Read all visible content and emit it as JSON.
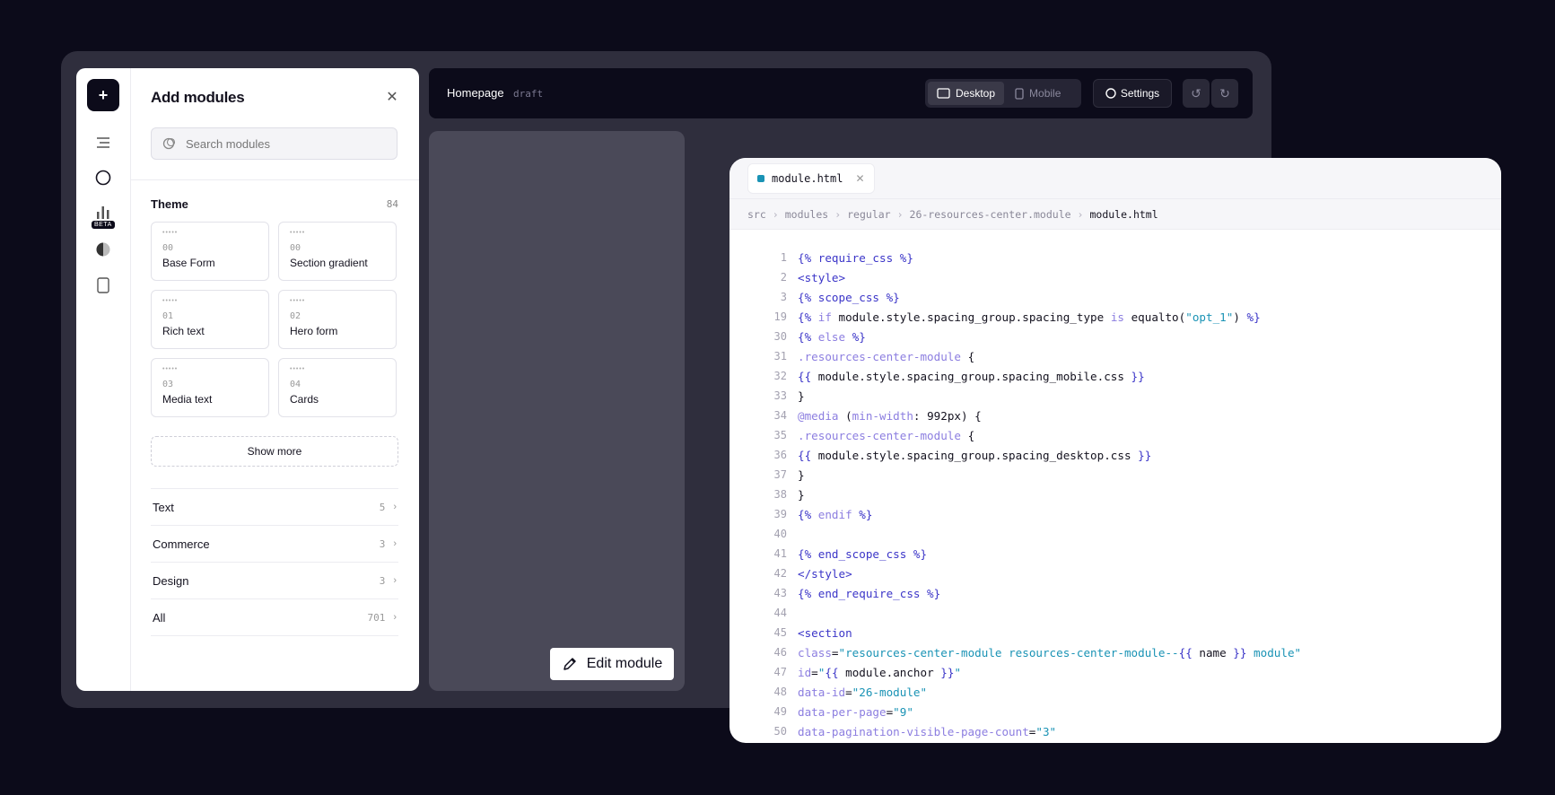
{
  "sidebar": {
    "add_icon": "plus-icon",
    "beta_label": "BETA",
    "items": [
      "layers-icon",
      "circle-icon",
      "chart-icon",
      "theme-icon",
      "page-icon"
    ]
  },
  "panel": {
    "title": "Add modules",
    "search_placeholder": "Search modules",
    "theme": {
      "label": "Theme",
      "count": "84"
    },
    "modules": [
      {
        "num": "00",
        "name": "Base Form"
      },
      {
        "num": "00",
        "name": "Section gradient"
      },
      {
        "num": "01",
        "name": "Rich text"
      },
      {
        "num": "02",
        "name": "Hero form"
      },
      {
        "num": "03",
        "name": "Media text"
      },
      {
        "num": "04",
        "name": "Cards"
      }
    ],
    "show_more": "Show more",
    "categories": [
      {
        "label": "Text",
        "count": "5"
      },
      {
        "label": "Commerce",
        "count": "3"
      },
      {
        "label": "Design",
        "count": "3"
      },
      {
        "label": "All",
        "count": "701"
      }
    ]
  },
  "topbar": {
    "page_name": "Homepage",
    "status": "draft",
    "desktop_label": "Desktop",
    "mobile_label": "Mobile",
    "settings_label": "Settings"
  },
  "canvas": {
    "edit_label": "Edit module"
  },
  "editor": {
    "tab_name": "module.html",
    "breadcrumbs": [
      "src",
      "modules",
      "regular",
      "26-resources-center.module",
      "module.html"
    ],
    "line_numbers": [
      "1",
      "2",
      "3",
      "19",
      "30",
      "31",
      "32",
      "33",
      "34",
      "35",
      "36",
      "37",
      "38",
      "39",
      "40",
      "41",
      "42",
      "43",
      "44",
      "45",
      "46",
      "47",
      "48",
      "49",
      "50"
    ]
  },
  "colors": {
    "accent": "#1a93b5",
    "keyword": "#3b35c8",
    "attr": "#8c7ee0",
    "background": "#0c0b1a"
  }
}
